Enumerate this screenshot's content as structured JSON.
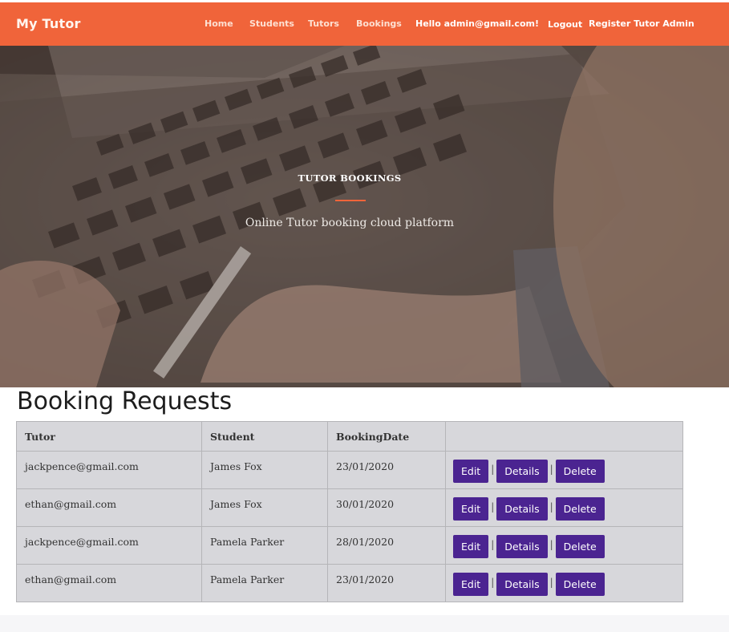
{
  "navbar": {
    "brand": "My Tutor",
    "links": [
      "Home",
      "Students",
      "Tutors",
      "Bookings"
    ],
    "greeting": "Hello admin@gmail.com!",
    "logout": "Logout",
    "register": "Register Tutor Admin",
    "bg_color": "#f0643a"
  },
  "hero": {
    "title": "TUTOR BOOKINGS",
    "subtitle": "Online Tutor booking cloud platform",
    "accent_color": "#f0643a"
  },
  "main": {
    "heading": "Booking Requests",
    "columns": [
      "Tutor",
      "Student",
      "BookingDate",
      ""
    ],
    "rows": [
      {
        "tutor": "jackpence@gmail.com",
        "student": "James Fox",
        "date": "23/01/2020"
      },
      {
        "tutor": "ethan@gmail.com",
        "student": "James Fox",
        "date": "30/01/2020"
      },
      {
        "tutor": "jackpence@gmail.com",
        "student": "Pamela Parker",
        "date": "28/01/2020"
      },
      {
        "tutor": "ethan@gmail.com",
        "student": "Pamela Parker",
        "date": "23/01/2020"
      }
    ],
    "actions": {
      "edit": "Edit",
      "details": "Details",
      "delete": "Delete",
      "separator": "|"
    },
    "button_color": "#4b2491"
  }
}
